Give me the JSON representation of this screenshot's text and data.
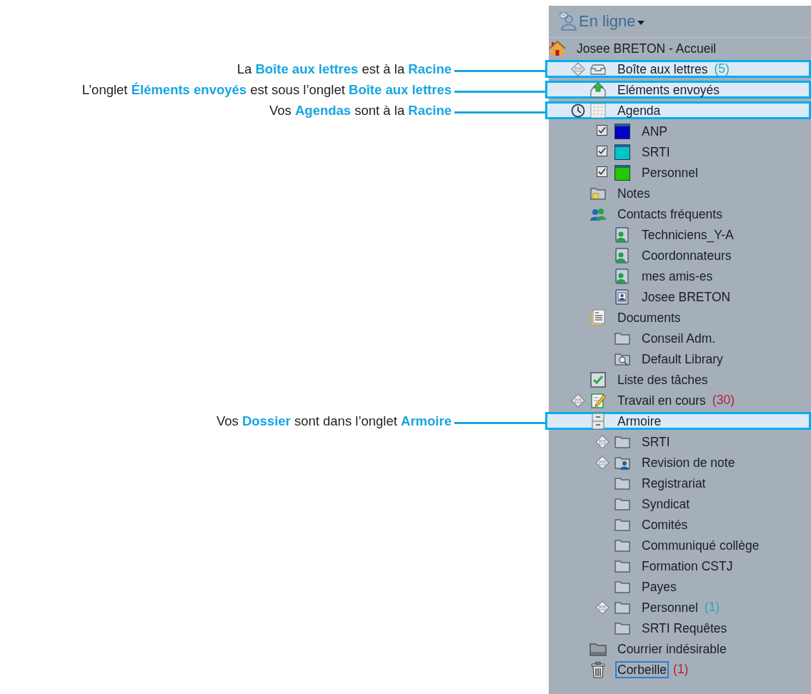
{
  "status": {
    "label": "En ligne"
  },
  "tree": [
    {
      "label": "Josee BRETON - Accueil",
      "kind": "home",
      "selected": false,
      "children": [
        {
          "label": "Boîte aux lettres",
          "kind": "mailbox",
          "marker": {
            "kind": "envelope"
          },
          "count": {
            "text": "(5)",
            "color": "#2ea8b6"
          },
          "selected": false,
          "callout": {
            "text": "La **Boîte aux lettres** est à la **Racine**"
          }
        },
        {
          "label": "Eléments envoyés",
          "kind": "sent",
          "selected": false,
          "callout": {
            "text": "L’onglet **Éléments envoyés** est sous l’onglet **Boîte aux lettres**"
          }
        },
        {
          "label": "Agenda",
          "kind": "calendar",
          "marker": {
            "kind": "clock"
          },
          "selected": false,
          "callout": {
            "text": "Vos **Agendas** sont à la **Racine**"
          },
          "children": [
            {
              "label": "ANP",
              "kind": "calendar-item",
              "checked": true,
              "color": "#0000c8",
              "selected": false
            },
            {
              "label": "SRTI",
              "kind": "calendar-item",
              "checked": true,
              "color": "#00c4c8",
              "selected": false
            },
            {
              "label": "Personnel",
              "kind": "calendar-item",
              "checked": true,
              "color": "#22c800",
              "selected": false
            }
          ]
        },
        {
          "label": "Notes",
          "kind": "notes",
          "selected": false
        },
        {
          "label": "Contacts fréquents",
          "kind": "contacts",
          "selected": false,
          "children": [
            {
              "label": "Techniciens_Y-A",
              "kind": "group",
              "selected": false
            },
            {
              "label": "Coordonnateurs",
              "kind": "group",
              "selected": false
            },
            {
              "label": "mes amis-es",
              "kind": "group",
              "selected": false
            },
            {
              "label": "Josee BRETON",
              "kind": "person",
              "selected": false
            }
          ]
        },
        {
          "label": "Documents",
          "kind": "documents",
          "selected": false,
          "children": [
            {
              "label": "Conseil Adm.",
              "kind": "folder",
              "selected": false
            },
            {
              "label": "Default Library",
              "kind": "library",
              "selected": false
            }
          ]
        },
        {
          "label": "Liste des tâches",
          "kind": "tasks",
          "selected": false
        },
        {
          "label": "Travail en cours",
          "kind": "work",
          "marker": {
            "kind": "envelope"
          },
          "count": {
            "text": "(30)",
            "color": "#b52240"
          },
          "selected": false
        },
        {
          "label": "Armoire",
          "kind": "cabinet",
          "selected": false,
          "callout": {
            "text": "Vos **Dossier** sont dans l’onglet **Armoire**"
          },
          "children": [
            {
              "label": "SRTI",
              "kind": "folder",
              "marker": {
                "kind": "envelope"
              },
              "selected": false
            },
            {
              "label": "Revision de note",
              "kind": "shared",
              "marker": {
                "kind": "envelope"
              },
              "selected": false
            },
            {
              "label": "Registrariat",
              "kind": "folder",
              "selected": false
            },
            {
              "label": "Syndicat",
              "kind": "folder",
              "selected": false
            },
            {
              "label": "Comités",
              "kind": "folder",
              "selected": false
            },
            {
              "label": "Communiqué collège",
              "kind": "folder",
              "selected": false
            },
            {
              "label": "Formation CSTJ",
              "kind": "folder",
              "selected": false
            },
            {
              "label": "Payes",
              "kind": "folder",
              "selected": false
            },
            {
              "label": "Personnel",
              "kind": "folder",
              "marker": {
                "kind": "envelope"
              },
              "count": {
                "text": "(1)",
                "color": "#2ea8b6"
              },
              "selected": false
            },
            {
              "label": "SRTI Requêtes",
              "kind": "folder",
              "selected": false
            }
          ]
        },
        {
          "label": "Courrier indésirable",
          "kind": "junk",
          "selected": false
        },
        {
          "label": "Corbeille",
          "kind": "trash",
          "count": {
            "text": "(1)",
            "color": "#b52240"
          },
          "selected": true
        }
      ]
    }
  ]
}
